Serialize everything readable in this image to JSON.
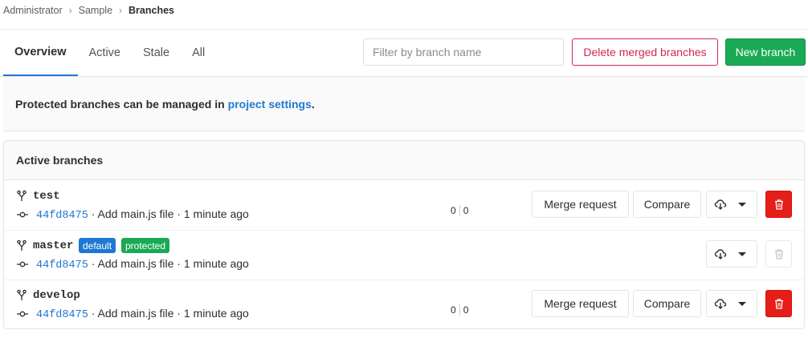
{
  "breadcrumb": {
    "items": [
      "Administrator",
      "Sample",
      "Branches"
    ]
  },
  "tabs": [
    {
      "label": "Overview",
      "active": true
    },
    {
      "label": "Active",
      "active": false
    },
    {
      "label": "Stale",
      "active": false
    },
    {
      "label": "All",
      "active": false
    }
  ],
  "filter": {
    "placeholder": "Filter by branch name",
    "value": ""
  },
  "actions": {
    "delete_merged_label": "Delete merged branches",
    "new_branch_label": "New branch"
  },
  "notice": {
    "text": "Protected branches can be managed in",
    "link": "project settings",
    "suffix": "."
  },
  "active_branches": {
    "title": "Active branches",
    "rows": [
      {
        "name": "test",
        "sha": "44fd8475",
        "commit_text": "· Add main.js file · 1 minute ago",
        "behind": "0",
        "ahead": "0",
        "merge_request_label": "Merge request",
        "compare_label": "Compare"
      },
      {
        "name": "master",
        "badge_default": "default",
        "badge_protected": "protected",
        "sha": "44fd8475",
        "commit_text": "· Add main.js file · 1 minute ago"
      },
      {
        "name": "develop",
        "sha": "44fd8475",
        "commit_text": "· Add main.js file · 1 minute ago",
        "behind": "0",
        "ahead": "0",
        "merge_request_label": "Merge request",
        "compare_label": "Compare"
      }
    ]
  },
  "icons": {
    "branch": "branch-icon",
    "commit": "commit-icon",
    "download": "download-icon",
    "trash": "trash-icon",
    "chevron": "chevron-down-icon"
  },
  "colors": {
    "link": "#1f78d1",
    "success": "#1aaa55",
    "danger": "#e51e18",
    "danger_outline": "#d22852"
  }
}
